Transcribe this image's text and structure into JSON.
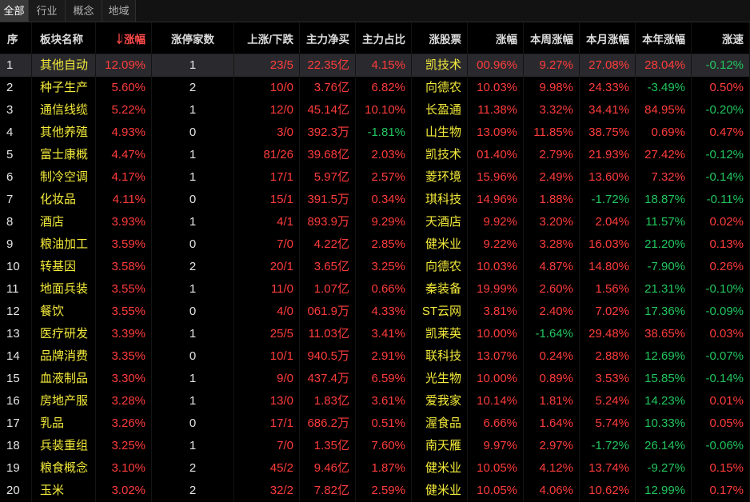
{
  "tabs": [
    {
      "label": "全部",
      "active": true
    },
    {
      "label": "行业",
      "active": false
    },
    {
      "label": "概念",
      "active": false
    },
    {
      "label": "地域",
      "active": false
    }
  ],
  "header": {
    "no": "序",
    "name": "板块名称",
    "chg": "涨幅",
    "limit_up": "涨停家数",
    "up_down": "上涨/下跌",
    "net_buy": "主力净买",
    "net_ratio": "主力占比",
    "leader": "涨股票",
    "leader_chg": "涨幅",
    "week": "本周涨幅",
    "month": "本月涨幅",
    "ytd": "本年涨幅",
    "speed": "涨速",
    "sort_icon": "sort-desc-icon"
  },
  "colors": {
    "up": "#ff3c3c",
    "down": "#22c55e",
    "name": "#f3ea3b",
    "text": "#e6e6e6",
    "selected_row_bg": "#2a2a2e",
    "background": "#000000"
  },
  "rows": [
    {
      "no": "1",
      "name": "其他自动",
      "chg": "12.09%",
      "limit_up": "1",
      "up_down": "23/5",
      "net_buy": "22.35亿",
      "net_ratio": "4.15%",
      "leader": "凯技术",
      "leader_chg": "00.96%",
      "week": "9.27%",
      "month": "27.08%",
      "ytd": "28.04%",
      "ytd_color": "#ff3c3c",
      "speed": "-0.12%",
      "selected": true
    },
    {
      "no": "2",
      "name": "种子生产",
      "chg": "5.60%",
      "limit_up": "2",
      "up_down": "10/0",
      "net_buy": "3.76亿",
      "net_ratio": "6.82%",
      "leader": "向德农",
      "leader_chg": "10.03%",
      "week": "9.98%",
      "month": "24.33%",
      "ytd": "-3.49%",
      "ytd_color": "#22c55e",
      "speed": "0.50%"
    },
    {
      "no": "3",
      "name": "通信线缆",
      "chg": "5.22%",
      "limit_up": "1",
      "up_down": "12/0",
      "net_buy": "45.14亿",
      "net_ratio": "10.10%",
      "leader": "长盈通",
      "leader_chg": "11.38%",
      "week": "3.32%",
      "month": "34.41%",
      "ytd": "84.95%",
      "ytd_color": "#ff3c3c",
      "speed": "-0.20%"
    },
    {
      "no": "4",
      "name": "其他养殖",
      "chg": "4.93%",
      "limit_up": "0",
      "up_down": "3/0",
      "net_buy": "392.3万",
      "net_ratio": "-1.81%",
      "leader": "山生物",
      "leader_chg": "13.09%",
      "week": "11.85%",
      "month": "38.75%",
      "ytd": "0.69%",
      "ytd_color": "#ff3c3c",
      "speed": "0.47%"
    },
    {
      "no": "5",
      "name": "富士康概",
      "chg": "4.47%",
      "limit_up": "1",
      "up_down": "81/26",
      "net_buy": "39.68亿",
      "net_ratio": "2.03%",
      "leader": "凯技术",
      "leader_chg": "01.40%",
      "week": "2.79%",
      "month": "21.93%",
      "ytd": "27.42%",
      "ytd_color": "#ff3c3c",
      "speed": "-0.12%"
    },
    {
      "no": "6",
      "name": "制冷空调",
      "chg": "4.17%",
      "limit_up": "1",
      "up_down": "17/1",
      "net_buy": "5.97亿",
      "net_ratio": "2.57%",
      "leader": "菱环境",
      "leader_chg": "15.96%",
      "week": "2.49%",
      "month": "13.60%",
      "ytd": "7.32%",
      "ytd_color": "#ff3c3c",
      "speed": "-0.14%"
    },
    {
      "no": "7",
      "name": "化妆品",
      "chg": "4.11%",
      "limit_up": "0",
      "up_down": "15/1",
      "net_buy": "391.5万",
      "net_ratio": "0.34%",
      "leader": "琪科技",
      "leader_chg": "14.96%",
      "week": "1.88%",
      "month": "-1.72%",
      "ytd": "18.87%",
      "ytd_color": "#22c55e",
      "speed": "-0.11%"
    },
    {
      "no": "8",
      "name": "酒店",
      "chg": "3.93%",
      "limit_up": "1",
      "up_down": "4/1",
      "net_buy": "893.9万",
      "net_ratio": "9.29%",
      "leader": "天酒店",
      "leader_chg": "9.92%",
      "week": "3.20%",
      "month": "2.04%",
      "ytd": "11.57%",
      "ytd_color": "#22c55e",
      "speed": "0.02%"
    },
    {
      "no": "9",
      "name": "粮油加工",
      "chg": "3.59%",
      "limit_up": "0",
      "up_down": "7/0",
      "net_buy": "4.22亿",
      "net_ratio": "2.85%",
      "leader": "健米业",
      "leader_chg": "9.22%",
      "week": "3.28%",
      "month": "16.03%",
      "ytd": "21.20%",
      "ytd_color": "#22c55e",
      "speed": "0.13%"
    },
    {
      "no": "10",
      "name": "转基因",
      "chg": "3.58%",
      "limit_up": "2",
      "up_down": "20/1",
      "net_buy": "3.65亿",
      "net_ratio": "3.25%",
      "leader": "向德农",
      "leader_chg": "10.03%",
      "week": "4.87%",
      "month": "14.80%",
      "ytd": "-7.90%",
      "ytd_color": "#22c55e",
      "speed": "0.26%"
    },
    {
      "no": "11",
      "name": "地面兵装",
      "chg": "3.55%",
      "limit_up": "1",
      "up_down": "11/0",
      "net_buy": "1.07亿",
      "net_ratio": "0.66%",
      "leader": "秦装备",
      "leader_chg": "19.99%",
      "week": "2.60%",
      "month": "1.56%",
      "ytd": "21.31%",
      "ytd_color": "#22c55e",
      "speed": "-0.10%"
    },
    {
      "no": "12",
      "name": "餐饮",
      "chg": "3.55%",
      "limit_up": "0",
      "up_down": "4/0",
      "net_buy": "061.9万",
      "net_ratio": "4.33%",
      "leader": "ST云网",
      "leader_chg": "3.81%",
      "week": "2.40%",
      "month": "7.02%",
      "ytd": "17.36%",
      "ytd_color": "#22c55e",
      "speed": "-0.09%"
    },
    {
      "no": "13",
      "name": "医疗研发",
      "chg": "3.39%",
      "limit_up": "1",
      "up_down": "25/5",
      "net_buy": "11.03亿",
      "net_ratio": "3.41%",
      "leader": "凯莱英",
      "leader_chg": "10.00%",
      "week": "-1.64%",
      "month": "29.48%",
      "ytd": "38.65%",
      "ytd_color": "#ff3c3c",
      "speed": "0.03%"
    },
    {
      "no": "14",
      "name": "品牌消费",
      "chg": "3.35%",
      "limit_up": "0",
      "up_down": "10/1",
      "net_buy": "940.5万",
      "net_ratio": "2.91%",
      "leader": "联科技",
      "leader_chg": "13.07%",
      "week": "0.24%",
      "month": "2.88%",
      "ytd": "12.69%",
      "ytd_color": "#22c55e",
      "speed": "-0.07%"
    },
    {
      "no": "15",
      "name": "血液制品",
      "chg": "3.30%",
      "limit_up": "1",
      "up_down": "9/0",
      "net_buy": "437.4万",
      "net_ratio": "6.59%",
      "leader": "光生物",
      "leader_chg": "10.00%",
      "week": "0.89%",
      "month": "3.53%",
      "ytd": "15.85%",
      "ytd_color": "#22c55e",
      "speed": "-0.14%"
    },
    {
      "no": "16",
      "name": "房地产服",
      "chg": "3.28%",
      "limit_up": "1",
      "up_down": "13/0",
      "net_buy": "1.83亿",
      "net_ratio": "3.61%",
      "leader": "爱我家",
      "leader_chg": "10.14%",
      "week": "1.81%",
      "month": "5.24%",
      "ytd": "14.23%",
      "ytd_color": "#22c55e",
      "speed": "0.01%"
    },
    {
      "no": "17",
      "name": "乳品",
      "chg": "3.26%",
      "limit_up": "0",
      "up_down": "17/1",
      "net_buy": "686.2万",
      "net_ratio": "0.51%",
      "leader": "渥食品",
      "leader_chg": "6.66%",
      "week": "1.64%",
      "month": "5.74%",
      "ytd": "10.33%",
      "ytd_color": "#22c55e",
      "speed": "0.05%"
    },
    {
      "no": "18",
      "name": "兵装重组",
      "chg": "3.25%",
      "limit_up": "1",
      "up_down": "7/0",
      "net_buy": "1.35亿",
      "net_ratio": "7.60%",
      "leader": "南天雁",
      "leader_chg": "9.97%",
      "week": "2.97%",
      "month": "-1.72%",
      "ytd": "26.14%",
      "ytd_color": "#22c55e",
      "speed": "-0.06%"
    },
    {
      "no": "19",
      "name": "粮食概念",
      "chg": "3.10%",
      "limit_up": "2",
      "up_down": "45/2",
      "net_buy": "9.46亿",
      "net_ratio": "1.87%",
      "leader": "健米业",
      "leader_chg": "10.05%",
      "week": "4.12%",
      "month": "13.74%",
      "ytd": "-9.27%",
      "ytd_color": "#22c55e",
      "speed": "0.15%"
    },
    {
      "no": "20",
      "name": "玉米",
      "chg": "3.02%",
      "limit_up": "2",
      "up_down": "32/2",
      "net_buy": "7.82亿",
      "net_ratio": "2.59%",
      "leader": "健米业",
      "leader_chg": "10.05%",
      "week": "4.06%",
      "month": "10.62%",
      "ytd": "12.99%",
      "ytd_color": "#22c55e",
      "speed": "0.17%"
    }
  ]
}
